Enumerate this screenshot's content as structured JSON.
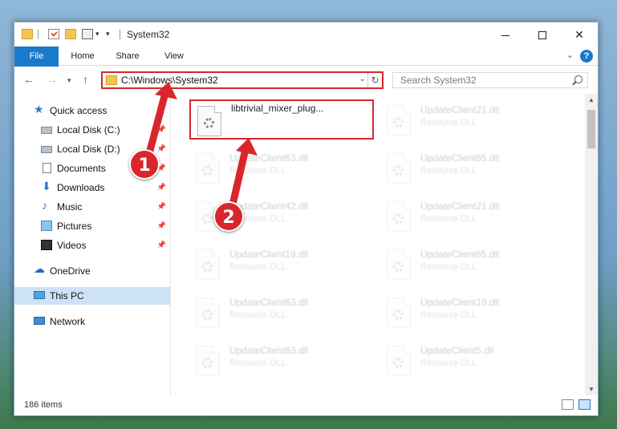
{
  "window": {
    "title": "System32",
    "minimize_label": "",
    "maximize_label": "",
    "close_label": "✕"
  },
  "ribbon": {
    "tabs": [
      {
        "label": "File"
      },
      {
        "label": "Home"
      },
      {
        "label": "Share"
      },
      {
        "label": "View"
      }
    ],
    "help_label": "?"
  },
  "address": {
    "path": "C:\\Windows\\System32",
    "search_placeholder": "Search System32"
  },
  "sidebar": {
    "items": [
      {
        "label": "Quick access",
        "icon": "star-icon"
      },
      {
        "label": "Local Disk (C:)",
        "icon": "drive-icon"
      },
      {
        "label": "Local Disk (D:)",
        "icon": "drive-icon"
      },
      {
        "label": "Documents",
        "icon": "documents-icon"
      },
      {
        "label": "Downloads",
        "icon": "download-icon"
      },
      {
        "label": "Music",
        "icon": "music-icon"
      },
      {
        "label": "Pictures",
        "icon": "pictures-icon"
      },
      {
        "label": "Videos",
        "icon": "videos-icon"
      },
      {
        "label": "OneDrive",
        "icon": "cloud-icon"
      },
      {
        "label": "This PC",
        "icon": "computer-icon"
      },
      {
        "label": "Network",
        "icon": "network-icon"
      }
    ]
  },
  "files": {
    "highlighted": {
      "name": "libtrivial_mixer_plug...",
      "type": ""
    },
    "items": [
      {
        "name": "UpdateClient21.dll",
        "type": "Resource DLL"
      },
      {
        "name": "UpdateClient63.dll",
        "type": "Resource DLL"
      },
      {
        "name": "UpdateClient65.dll",
        "type": "Resource DLL"
      },
      {
        "name": "UpdateClient42.dll",
        "type": "Resource DLL"
      },
      {
        "name": "UpdateClient21.dll",
        "type": "Resource DLL"
      },
      {
        "name": "UpdateClient19.dll",
        "type": "Resource DLL"
      },
      {
        "name": "UpdateClient65.dll",
        "type": "Resource DLL"
      },
      {
        "name": "UpdateClient63.dll",
        "type": "Resource DLL"
      },
      {
        "name": "UpdateClient19.dll",
        "type": "Resource DLL"
      },
      {
        "name": "UpdateClient63.dll",
        "type": "Resource DLL"
      },
      {
        "name": "UpdateClient5.dll",
        "type": "Resource DLL"
      }
    ]
  },
  "status": {
    "item_count": "186 items"
  },
  "callouts": {
    "one": "1",
    "two": "2"
  },
  "colors": {
    "accent": "#1979ca",
    "highlight_red": "#d9262c",
    "selection": "#cde2f6"
  }
}
